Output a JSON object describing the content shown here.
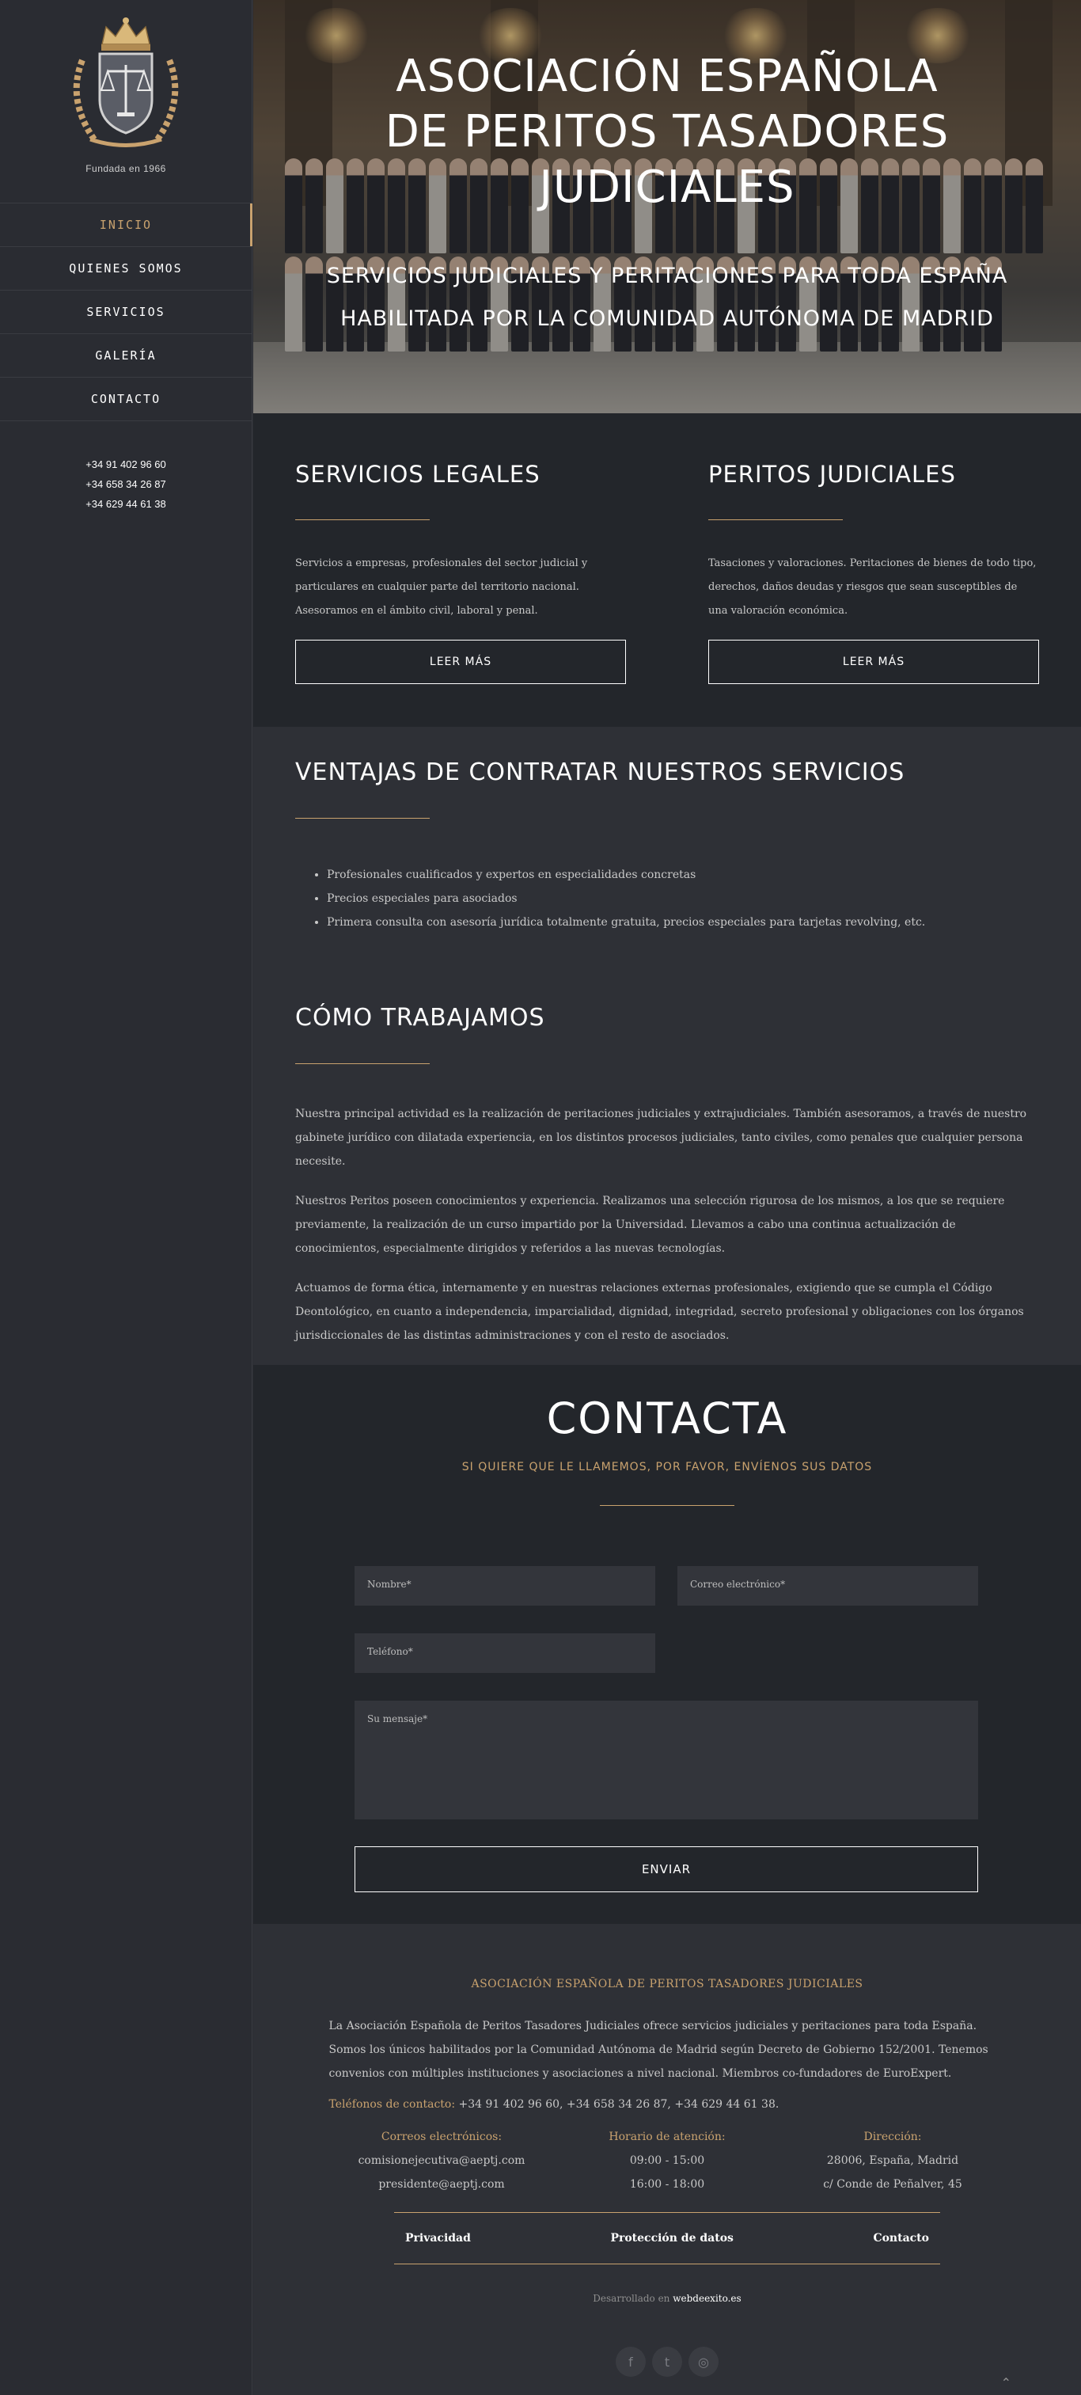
{
  "sidebar": {
    "founded": "Fundada en 1966",
    "nav": [
      {
        "label": "INICIO",
        "active": true
      },
      {
        "label": "QUIENES SOMOS"
      },
      {
        "label": "SERVICIOS"
      },
      {
        "label": "GALERÍA"
      },
      {
        "label": "CONTACTO"
      }
    ],
    "phones": [
      "+34 91 402 96 60",
      "+34 658 34 26 87",
      "+34 629 44 61 38"
    ]
  },
  "hero": {
    "title": "ASOCIACIÓN ESPAÑOLA DE PERITOS TASADORES JUDICIALES",
    "subtitle_line1": "SERVICIOS JUDICIALES Y PERITACIONES PARA TODA ESPAÑA",
    "subtitle_line2": "HABILITADA POR LA COMUNIDAD AUTÓNOMA DE MADRID"
  },
  "services": [
    {
      "title": "SERVICIOS LEGALES",
      "text": "Servicios a empresas, profesionales del sector judicial y particulares en cualquier parte del territorio nacional. Asesoramos en el ámbito civil, laboral y penal.",
      "button": "LEER MÁS"
    },
    {
      "title": "PERITOS JUDICIALES",
      "text": "Tasaciones y valoraciones. Peritaciones de bienes de todo tipo, derechos, daños deudas y riesgos que sean susceptibles de una valoración económica.",
      "button": "LEER MÁS"
    }
  ],
  "ventajas": {
    "title": "VENTAJAS DE CONTRATAR NUESTROS SERVICIOS",
    "items": [
      "Profesionales cualificados y expertos en especialidades concretas",
      "Precios especiales para asociados",
      "Primera consulta con asesoría jurídica totalmente gratuita, precios especiales para tarjetas revolving, etc."
    ]
  },
  "como": {
    "title": "CÓMO TRABAJAMOS",
    "paragraphs": [
      "Nuestra principal actividad es la realización de peritaciones judiciales y extrajudiciales. También asesoramos, a través de nuestro gabinete jurídico con dilatada experiencia, en los distintos procesos judiciales, tanto civiles, como penales que cualquier persona necesite.",
      "Nuestros Peritos poseen conocimientos y experiencia. Realizamos una selección rigurosa de los mismos, a los que se requiere previamente, la realización de un curso impartido por la Universidad. Llevamos a cabo una continua actualización de conocimientos, especialmente dirigidos y referidos a las nuevas tecnologías.",
      "Actuamos de forma ética, internamente y en nuestras relaciones externas profesionales, exigiendo que se cumpla el Código Deontológico, en cuanto a independencia, imparcialidad, dignidad, integridad, secreto profesional y obligaciones con los órganos jurisdiccionales de las distintas administraciones y con el resto de asociados."
    ]
  },
  "contacta": {
    "title": "CONTACTA",
    "subtitle": "SI QUIERE QUE LE LLAMEMOS, POR FAVOR, ENVÍENOS SUS DATOS",
    "name_placeholder": "Nombre*",
    "email_placeholder": "Correo electrónico*",
    "phone_placeholder": "Teléfono*",
    "message_placeholder": "Su mensaje*",
    "send": "ENVIAR"
  },
  "footer": {
    "title": "ASOCIACIÓN ESPAÑOLA DE PERITOS TASADORES JUDICIALES",
    "description": "La Asociación Española de Peritos Tasadores Judiciales ofrece servicios judiciales y peritaciones para toda España. Somos los únicos habilitados por la Comunidad Autónoma de Madrid según Decreto de Gobierno 152/2001. Tenemos convenios con múltiples instituciones y asociaciones a nivel nacional. Miembros co-fundadores de EuroExpert.",
    "phones_label": "Teléfonos de contacto:",
    "phones": " +34 91 402 96 60, +34 658 34 26 87, +34 629 44 61 38.",
    "email_label": "Correos electrónicos:",
    "emails": [
      "comisionejecutiva@aeptj.com",
      "presidente@aeptj.com"
    ],
    "hours_label": "Horario de atención:",
    "hours": [
      "09:00 - 15:00",
      "16:00 - 18:00"
    ],
    "address_label": "Dirección:",
    "address": [
      "28006, España, Madrid",
      "c/ Conde de Peñalver, 45"
    ],
    "links": [
      "Privacidad",
      "Protección de datos",
      "Contacto"
    ],
    "dev_prefix": "Desarrollado en ",
    "dev_name": "webdeexito.es",
    "social": [
      {
        "name": "facebook-icon",
        "glyph": "f"
      },
      {
        "name": "twitter-icon",
        "glyph": "t"
      },
      {
        "name": "instagram-icon",
        "glyph": "◎"
      }
    ],
    "to_top": "⌃"
  },
  "colors": {
    "accent": "#c9a26e",
    "dark_bg": "#23262b",
    "mid_bg": "#2e3036",
    "sidebar_bg": "#2a2c32"
  }
}
